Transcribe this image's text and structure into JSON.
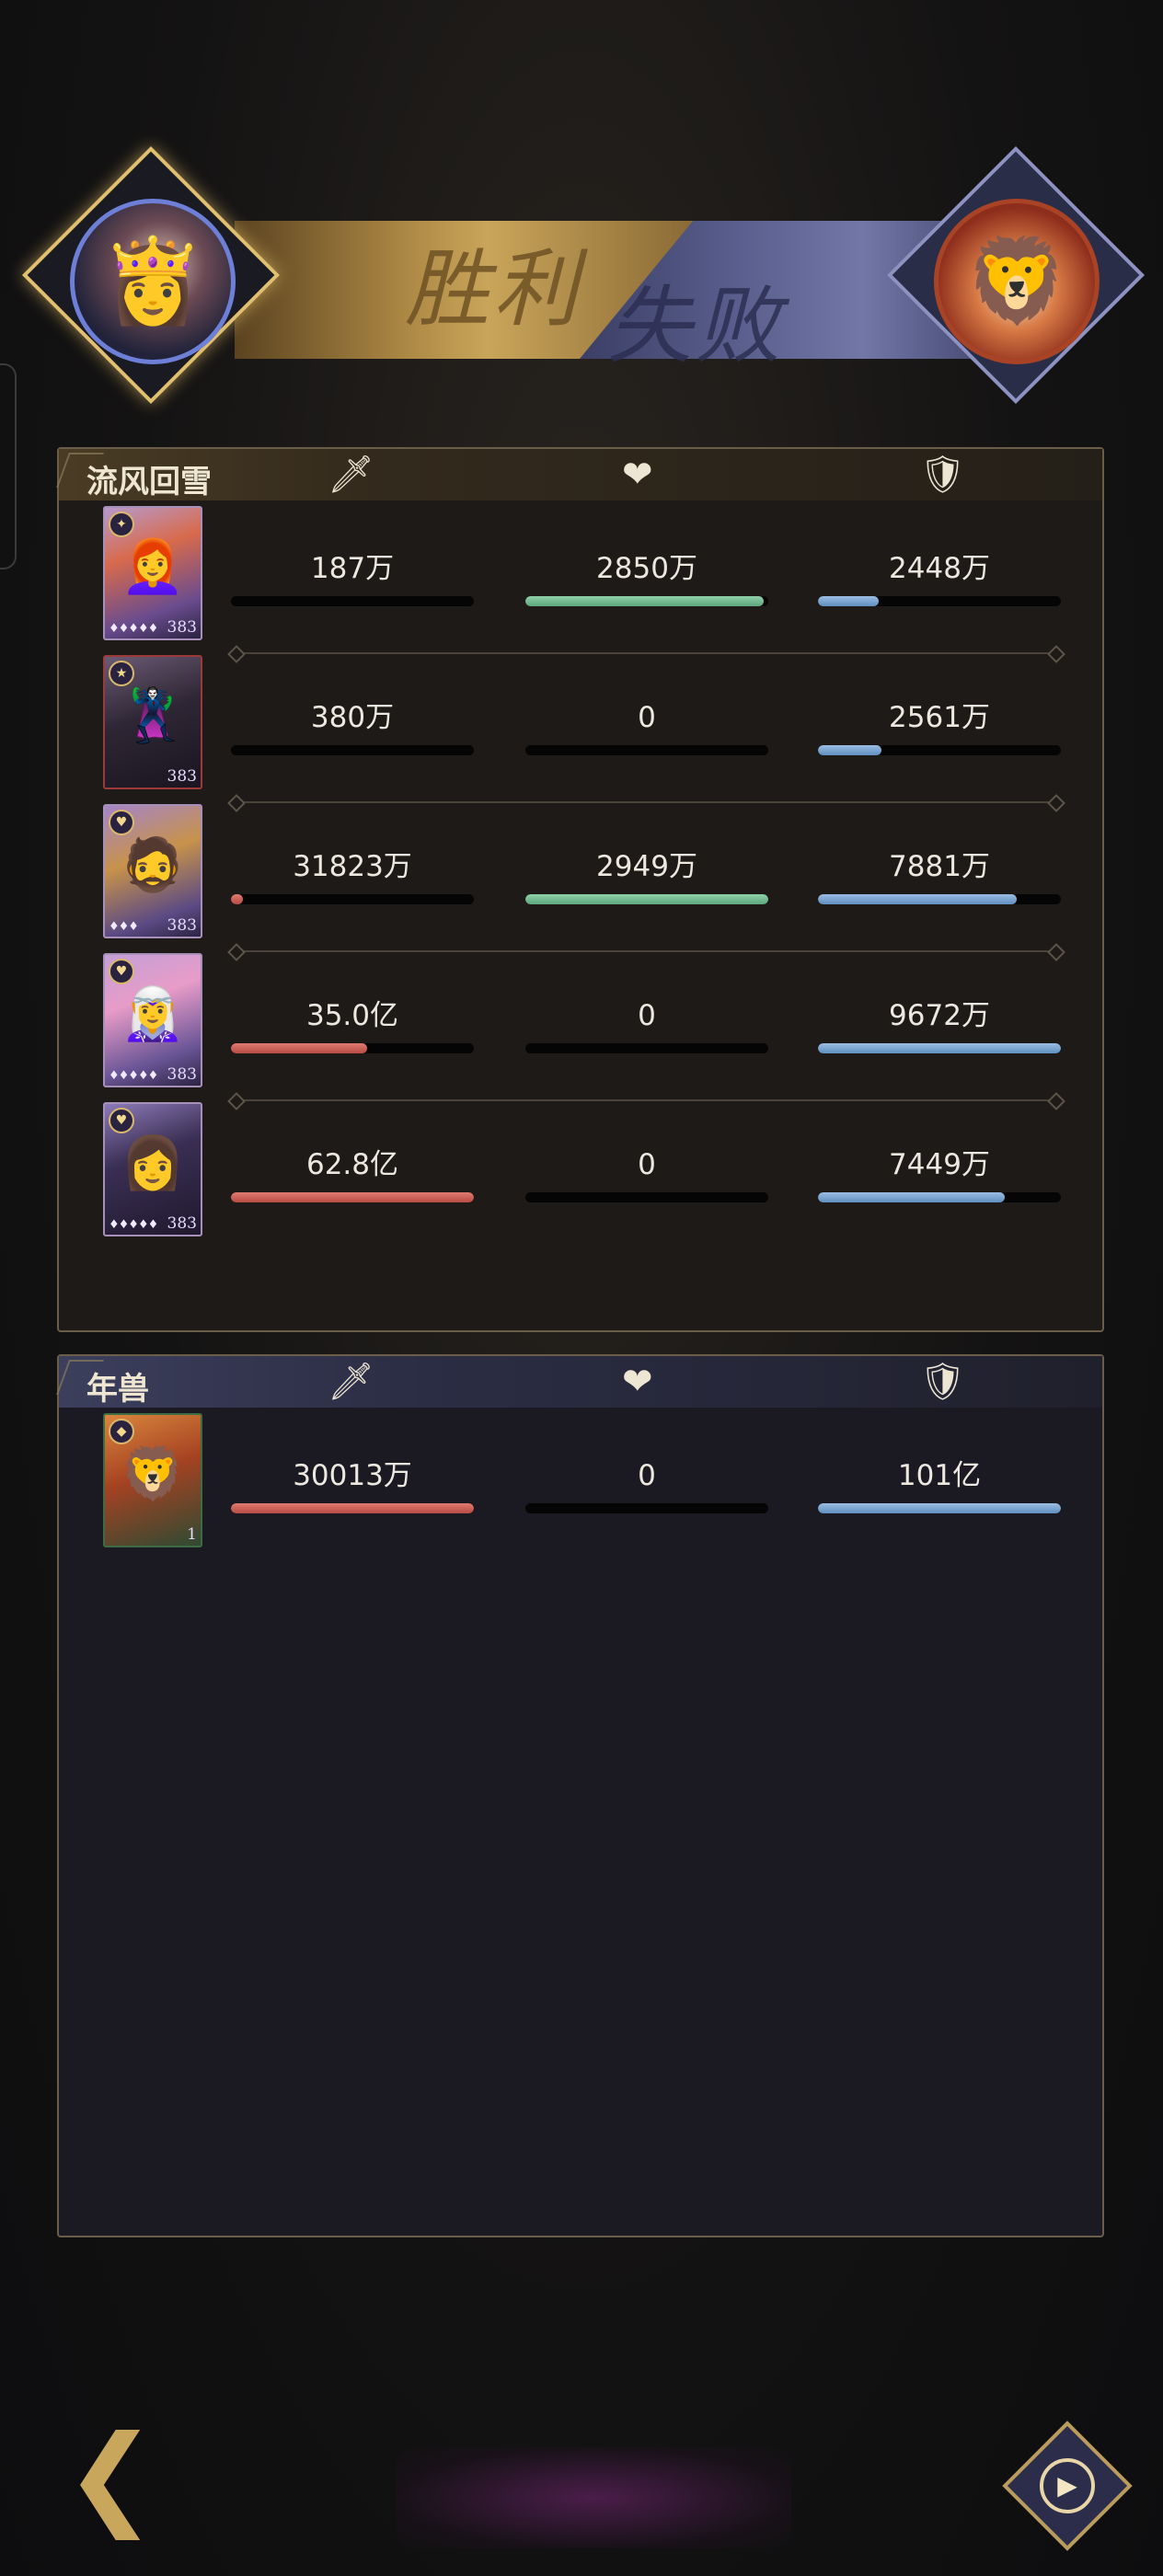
{
  "banner": {
    "victory_text": "胜利",
    "defeat_text": "失败"
  },
  "ally_team": {
    "name": "流风回雪",
    "rows": [
      {
        "level": "383",
        "damage": "187万",
        "damage_pct": 0,
        "healing": "2850万",
        "healing_pct": 98,
        "tank": "2448万",
        "tank_pct": 25
      },
      {
        "level": "383",
        "damage": "380万",
        "damage_pct": 0,
        "healing": "0",
        "healing_pct": 0,
        "tank": "2561万",
        "tank_pct": 26
      },
      {
        "level": "383",
        "damage": "31823万",
        "damage_pct": 5,
        "healing": "2949万",
        "healing_pct": 100,
        "tank": "7881万",
        "tank_pct": 82
      },
      {
        "level": "383",
        "damage": "35.0亿",
        "damage_pct": 56,
        "healing": "0",
        "healing_pct": 0,
        "tank": "9672万",
        "tank_pct": 100
      },
      {
        "level": "383",
        "damage": "62.8亿",
        "damage_pct": 100,
        "healing": "0",
        "healing_pct": 0,
        "tank": "7449万",
        "tank_pct": 77
      }
    ]
  },
  "enemy_team": {
    "name": "年兽",
    "rows": [
      {
        "level": "1",
        "damage": "30013万",
        "damage_pct": 100,
        "healing": "0",
        "healing_pct": 0,
        "tank": "101亿",
        "tank_pct": 100
      }
    ]
  },
  "icons": {
    "damage": "sword-icon",
    "healing": "heart-icon",
    "tank": "shield-icon",
    "back": "back-arrow-icon",
    "replay": "replay-icon"
  },
  "colors": {
    "damage_bar": "#c9554e",
    "healing_bar": "#74bb90",
    "tank_bar": "#7aa6d4",
    "gold_accent": "#c9a55a",
    "defeat_accent": "#5a5f8e"
  }
}
